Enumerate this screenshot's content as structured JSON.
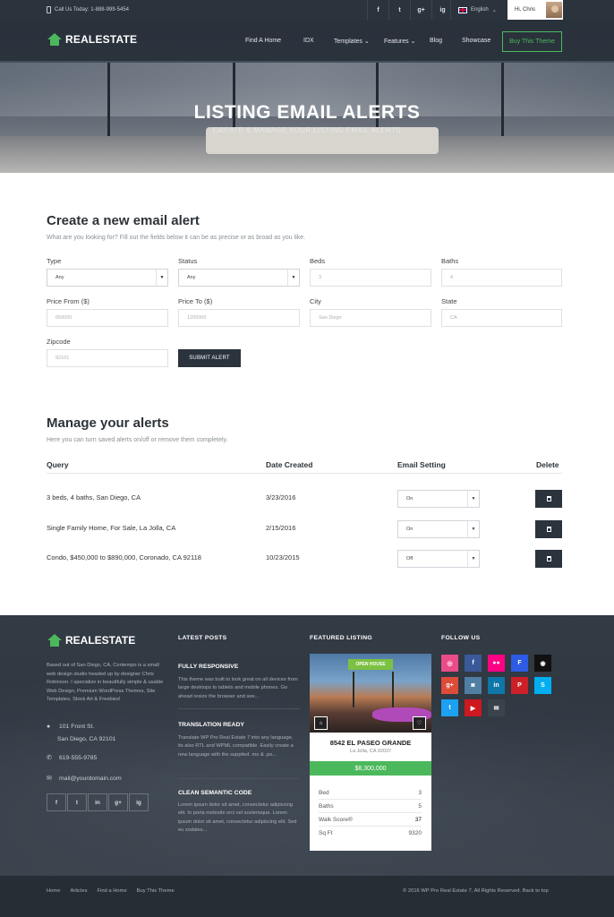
{
  "topbar": {
    "phone": "Call Us Today: 1-888-999-5454",
    "social": [
      "f",
      "t",
      "g+",
      "ig"
    ],
    "language": "English",
    "greeting": "Hi, Chris"
  },
  "nav": {
    "logo": "REALESTATE",
    "items": [
      "Find A Home",
      "IDX",
      "Templates",
      "Features",
      "Blog",
      "Showcase"
    ],
    "cta": "Buy This Theme"
  },
  "hero": {
    "title": "LISTING EMAIL ALERTS",
    "subtitle": "CREATE & MANAGE YOUR LISTING EMAIL ALERTS"
  },
  "create": {
    "title": "Create a new email alert",
    "subtitle": "What are you looking for? Fill out the fields below it can be as precise or as broad as you like.",
    "fields": {
      "type": {
        "label": "Type",
        "value": "Any"
      },
      "status": {
        "label": "Status",
        "value": "Any"
      },
      "beds": {
        "label": "Beds",
        "placeholder": "3"
      },
      "baths": {
        "label": "Baths",
        "placeholder": "4"
      },
      "price_from": {
        "label": "Price From ($)",
        "placeholder": "650000"
      },
      "price_to": {
        "label": "Price To ($)",
        "placeholder": "1200000"
      },
      "city": {
        "label": "City",
        "placeholder": "San Diego"
      },
      "state": {
        "label": "State",
        "placeholder": "CA"
      },
      "zipcode": {
        "label": "Zipcode",
        "placeholder": "92101"
      }
    },
    "submit": "SUBMIT ALERT"
  },
  "manage": {
    "title": "Manage your alerts",
    "subtitle": "Here you can turn saved alerts on/off or remove them completely.",
    "headers": {
      "query": "Query",
      "date": "Date Created",
      "setting": "Email Setting",
      "delete": "Delete"
    },
    "rows": [
      {
        "query": "3 beds, 4 baths, San Diego, CA",
        "date": "3/23/2016",
        "setting": "On"
      },
      {
        "query": "Single Family Home, For Sale, La Jolla, CA",
        "date": "2/15/2016",
        "setting": "On"
      },
      {
        "query": "Condo, $450,000 to $890,000, Coronado, CA 92118",
        "date": "10/23/2015",
        "setting": "Off"
      }
    ]
  },
  "footer": {
    "logo": "REALESTATE",
    "about": "Based out of San Diego, CA, Contempo is a small web design studio headed up by designer Chris Robinson. I specialize in beautifully simple & usable Web Design, Premium WordPress Themes, Site Templates, Stock Art & Freebies!",
    "address1": "101 Front St.",
    "address2": "San Diego, CA 92101",
    "phone": "619-555-9785",
    "email": "mail@yourdomain.com",
    "social": [
      "f",
      "t",
      "in",
      "g+",
      "ig"
    ],
    "latest_heading": "LATEST POSTS",
    "posts": [
      {
        "title": "FULLY RESPONSIVE",
        "text": "This theme was built to look great on all devices from large desktops to tablets and mobile phones. Go ahead resize the browser and see..."
      },
      {
        "title": "TRANSLATION READY",
        "text": "Translate WP Pro Real Estate 7 into any language, its also RTL and WPML compatible. Easily create a new language with the supplied .mo & .po..."
      },
      {
        "title": "CLEAN SEMANTIC CODE",
        "text": "Lorem ipsum dolor sit amet, consectetur adipiscing elit. In porta molestie orci vel scelerisque. Lorem ipsum dolor sit amet, consectetur adipiscing elit. Sed eu sodales..."
      }
    ],
    "featured_heading": "FEATURED LISTING",
    "listing": {
      "badge": "OPEN HOUSE",
      "title": "8542 EL PASEO GRANDE",
      "location": "La Jolla, CA 92037",
      "price": "$8,300,000",
      "specs": [
        {
          "label": "Bed",
          "value": "3"
        },
        {
          "label": "Baths",
          "value": "5"
        },
        {
          "label": "Walk Score®",
          "value": "37"
        },
        {
          "label": "Sq Ft",
          "value": "9320"
        }
      ]
    },
    "follow_heading": "FOLLOW US",
    "follow_icons": [
      {
        "name": "dribbble",
        "glyph": "◎",
        "color": "#ea4c89"
      },
      {
        "name": "facebook",
        "glyph": "f",
        "color": "#3b5998"
      },
      {
        "name": "flickr",
        "glyph": "●●",
        "color": "#ff0084"
      },
      {
        "name": "foursquare",
        "glyph": "F",
        "color": "#2d5be3"
      },
      {
        "name": "github",
        "glyph": "◉",
        "color": "#111111"
      },
      {
        "name": "google-plus",
        "glyph": "g+",
        "color": "#dd4b39"
      },
      {
        "name": "instagram",
        "glyph": "◙",
        "color": "#517fa4"
      },
      {
        "name": "linkedin",
        "glyph": "in",
        "color": "#0e76a8"
      },
      {
        "name": "pinterest",
        "glyph": "P",
        "color": "#cb2027"
      },
      {
        "name": "skype",
        "glyph": "S",
        "color": "#00aff0"
      },
      {
        "name": "twitter",
        "glyph": "t",
        "color": "#1da1f2"
      },
      {
        "name": "youtube",
        "glyph": "▶",
        "color": "#cc181e"
      },
      {
        "name": "email",
        "glyph": "✉",
        "color": "#3a424c"
      }
    ],
    "bottom_links": [
      "Home",
      "Articles",
      "Find a Home",
      "Buy This Theme"
    ],
    "copyright": "© 2016 WP Pro Real Estate 7, All Rights Reserved. Back to top"
  },
  "colors": {
    "accent": "#4cb85c",
    "dark": "#2b333d"
  }
}
